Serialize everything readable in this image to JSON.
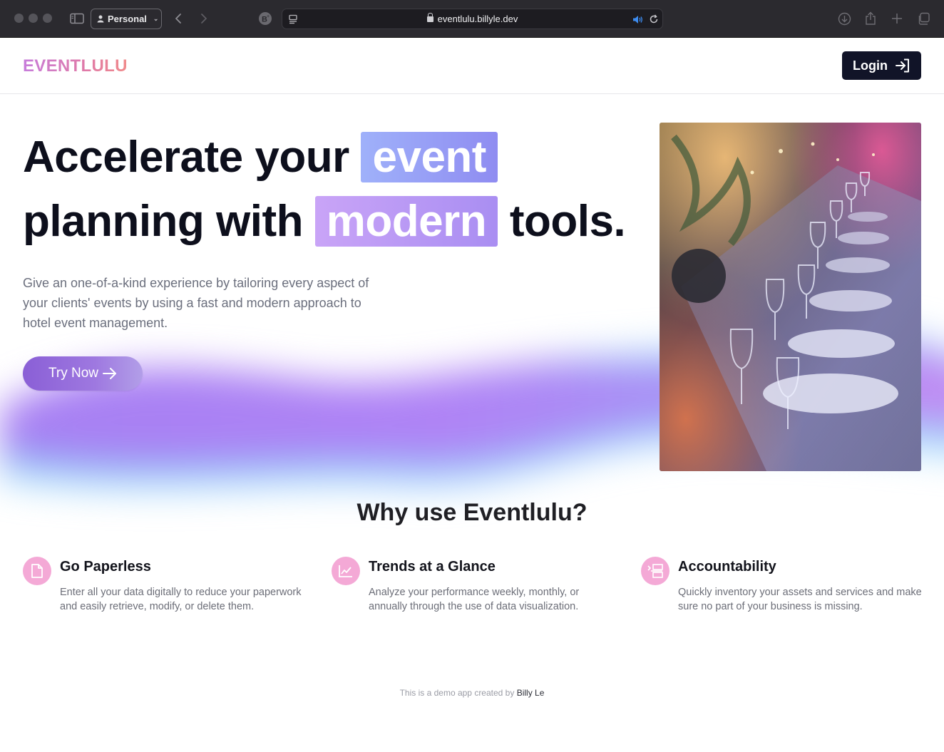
{
  "browser": {
    "profile_label": "Personal",
    "url": "eventlulu.billyle.dev"
  },
  "header": {
    "logo": "EVENTLULU",
    "login_label": "Login"
  },
  "hero": {
    "title_part1": "Accelerate your",
    "title_highlight1": "event",
    "title_part2": "planning with",
    "title_highlight2": "modern",
    "title_part3": "tools.",
    "description": "Give an one-of-a-kind experience by tailoring every aspect of your clients' events by using a fast and modern approach to hotel event management.",
    "cta_label": "Try Now"
  },
  "why": {
    "title": "Why use Eventlulu?",
    "features": [
      {
        "icon": "document-icon",
        "title": "Go Paperless",
        "description": "Enter all your data digitally to reduce your paperwork and easily retrieve, modify, or delete them."
      },
      {
        "icon": "chart-icon",
        "title": "Trends at a Glance",
        "description": "Analyze your performance weekly, monthly, or annually through the use of data visualization."
      },
      {
        "icon": "checklist-icon",
        "title": "Accountability",
        "description": "Quickly inventory your assets and services and make sure no part of your business is missing."
      }
    ]
  },
  "footer": {
    "text": "This is a demo app created by",
    "author": "Billy Le"
  },
  "colors": {
    "accent_dark": "#111428",
    "icon_bg": "#f4a9d6",
    "cta_gradient_start": "#8a5fd6"
  }
}
